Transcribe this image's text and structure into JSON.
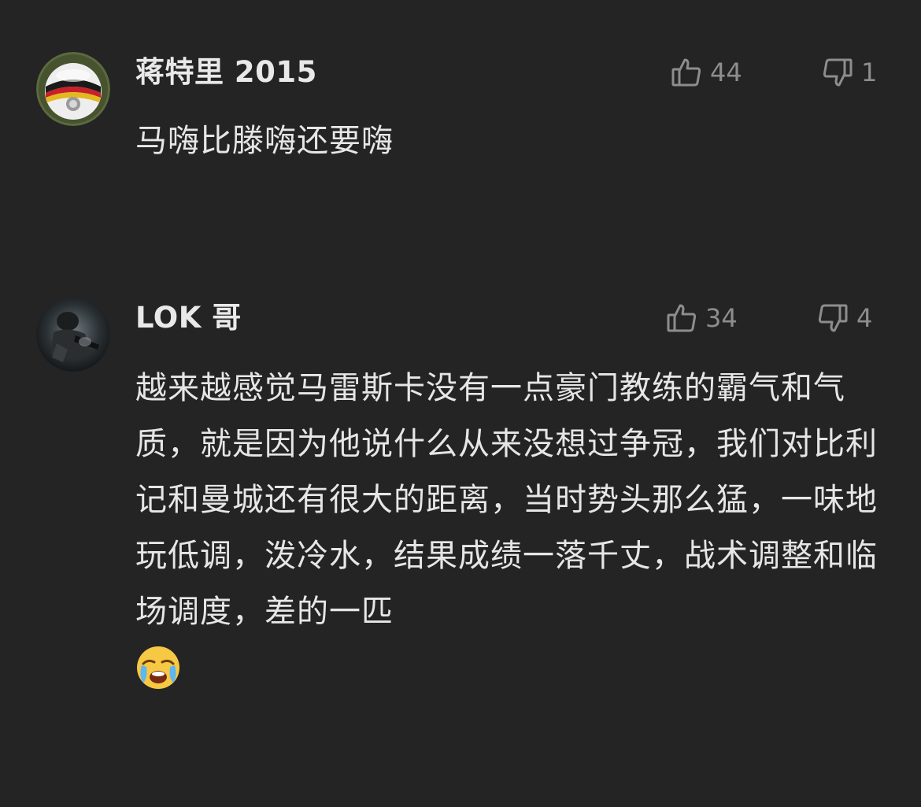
{
  "comments": [
    {
      "username": "蒋特里 2015",
      "avatar_icon": "football-avatar-icon",
      "likes": "44",
      "dislikes": "1",
      "text": "马嗨比滕嗨还要嗨"
    },
    {
      "username": "LOK 哥",
      "avatar_icon": "soldier-avatar-icon",
      "likes": "34",
      "dislikes": "4",
      "text": "越来越感觉马雷斯卡没有一点豪门教练的霸气和气质，就是因为他说什么从来没想过争冠，我们对比利记和曼城还有很大的距离，当时势头那么猛，一味地玩低调，泼冷水，结果成绩一落千丈，战术调整和临场调度，差的一匹",
      "emoji": "crying-face-emoji"
    }
  ],
  "colors": {
    "background": "#242424",
    "text": "#e6e6e6",
    "muted": "#8d8d8d"
  }
}
